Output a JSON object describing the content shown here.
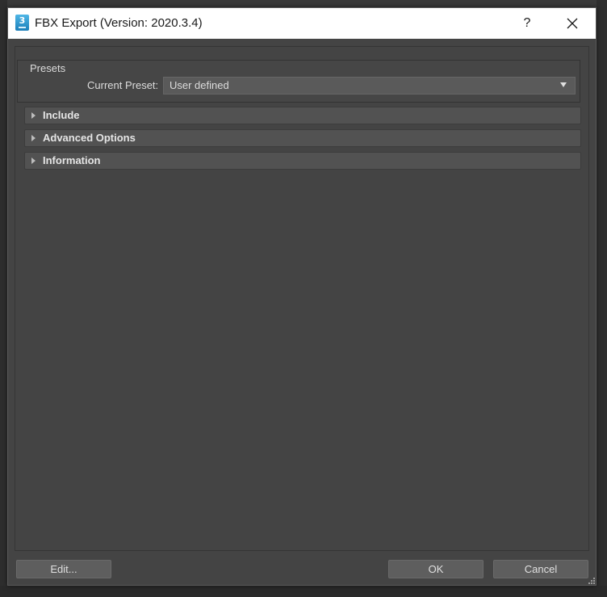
{
  "window": {
    "title": "FBX Export (Version: 2020.3.4)",
    "app_icon": "3ds-max-app-icon",
    "app_icon_digit": "3",
    "help_label": "?",
    "close_icon": "close-icon"
  },
  "presets": {
    "group_title": "Presets",
    "current_preset_label": "Current Preset:",
    "current_preset_value": "User defined",
    "dropdown_icon": "chevron-down-icon"
  },
  "sections": [
    {
      "label": "Include",
      "expanded": false,
      "icon": "chevron-right-icon"
    },
    {
      "label": "Advanced Options",
      "expanded": false,
      "icon": "chevron-right-icon"
    },
    {
      "label": "Information",
      "expanded": false,
      "icon": "chevron-right-icon"
    }
  ],
  "buttons": {
    "edit": "Edit...",
    "ok": "OK",
    "cancel": "Cancel"
  },
  "colors": {
    "titlebar": "#ffffff",
    "dialog_background": "#444444",
    "section_header": "#525252",
    "button": "#5e5e5e",
    "app_icon_accent": "#1b7fb9"
  }
}
